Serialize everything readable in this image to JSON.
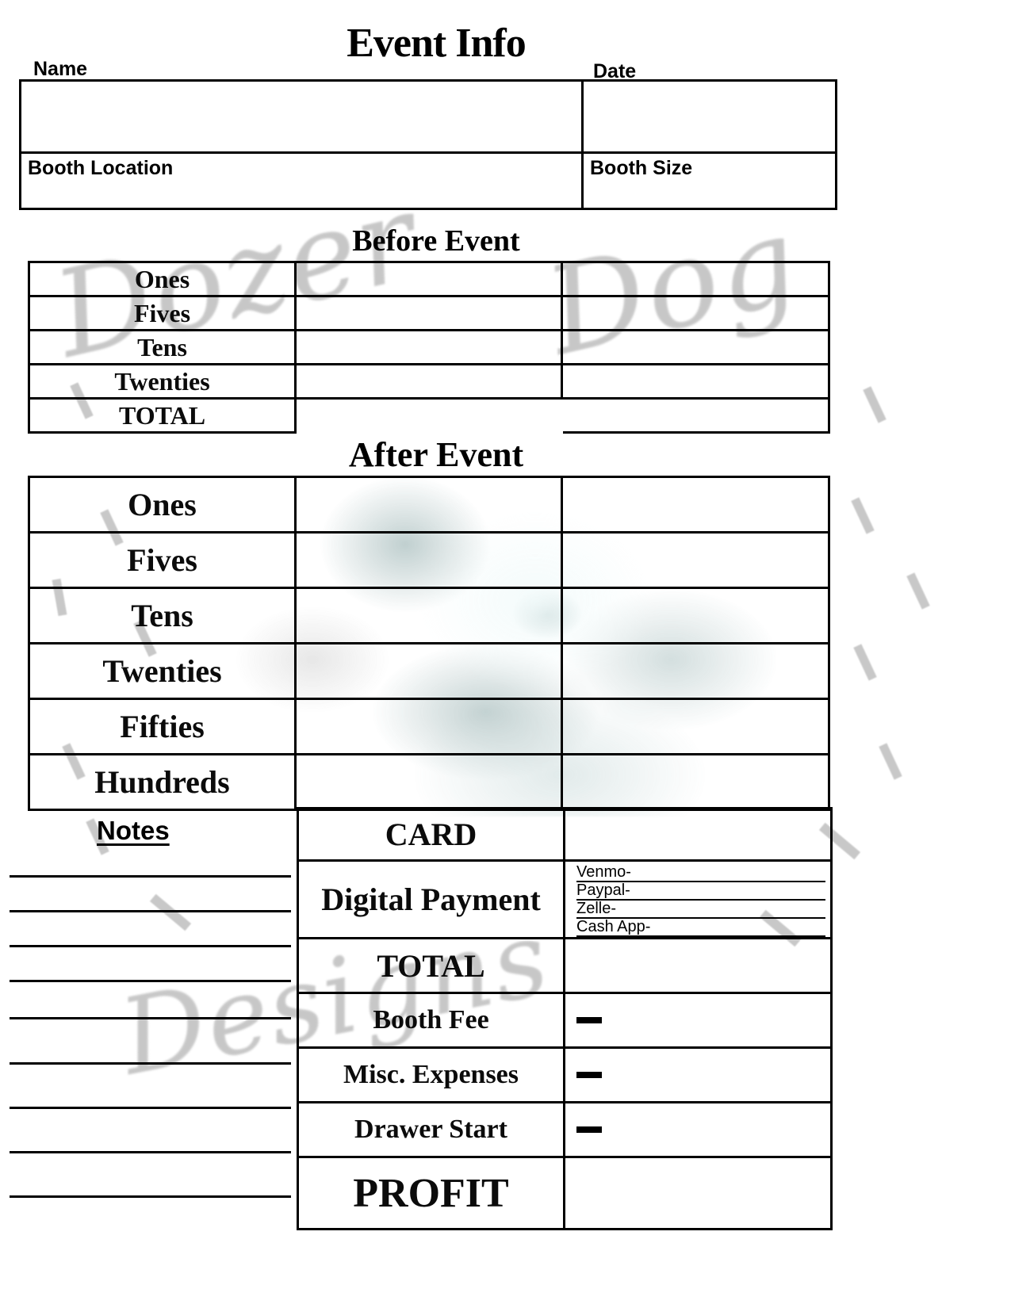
{
  "document": {
    "kind": "event-cash-tracking-worksheet",
    "watermarks": {
      "brand_line1": "Dozer",
      "brand_line2": "Dog",
      "brand_line3": "Designs"
    }
  },
  "event_info": {
    "title": "Event Info",
    "captions": {
      "name": "Name",
      "date": "Date"
    },
    "fields": {
      "name_value": "",
      "date_value": "",
      "booth_location_label": "Booth Location",
      "booth_location_value": "",
      "booth_size_label": "Booth Size",
      "booth_size_value": ""
    }
  },
  "before_event": {
    "title": "Before Event",
    "rows": [
      {
        "label": "Ones",
        "count": "",
        "amount": ""
      },
      {
        "label": "Fives",
        "count": "",
        "amount": ""
      },
      {
        "label": "Tens",
        "count": "",
        "amount": ""
      },
      {
        "label": "Twenties",
        "count": "",
        "amount": ""
      },
      {
        "label": "TOTAL",
        "count": "",
        "amount": ""
      }
    ]
  },
  "after_event": {
    "title": "After Event",
    "rows": [
      {
        "label": "Ones",
        "count": "",
        "amount": ""
      },
      {
        "label": "Fives",
        "count": "",
        "amount": ""
      },
      {
        "label": "Tens",
        "count": "",
        "amount": ""
      },
      {
        "label": "Twenties",
        "count": "",
        "amount": ""
      },
      {
        "label": "Fifties",
        "count": "",
        "amount": ""
      },
      {
        "label": "Hundreds",
        "count": "",
        "amount": ""
      }
    ]
  },
  "payments": {
    "card": {
      "label": "CARD",
      "value": ""
    },
    "digital": {
      "label": "Digital Payment",
      "methods": [
        {
          "name": "Venmo-",
          "value": ""
        },
        {
          "name": "Paypal-",
          "value": ""
        },
        {
          "name": "Zelle-",
          "value": ""
        },
        {
          "name": "Cash App-",
          "value": ""
        }
      ]
    },
    "total": {
      "label": "TOTAL",
      "value": ""
    },
    "booth_fee": {
      "label": "Booth Fee",
      "value": "",
      "sign": "minus"
    },
    "misc_expenses": {
      "label": "Misc. Expenses",
      "value": "",
      "sign": "minus"
    },
    "drawer_start": {
      "label": "Drawer Start",
      "value": "",
      "sign": "minus"
    },
    "profit": {
      "label": "PROFIT",
      "value": ""
    }
  },
  "notes": {
    "title": "Notes",
    "line_count": 9,
    "lines": [
      "",
      "",
      "",
      "",
      "",
      "",
      "",
      "",
      ""
    ]
  },
  "colors": {
    "fill_teal": "#a8d8d4",
    "label_pale": "#e4f2f2",
    "border": "#000000",
    "page": "#ffffff",
    "watermark": "#9b9b9b"
  }
}
